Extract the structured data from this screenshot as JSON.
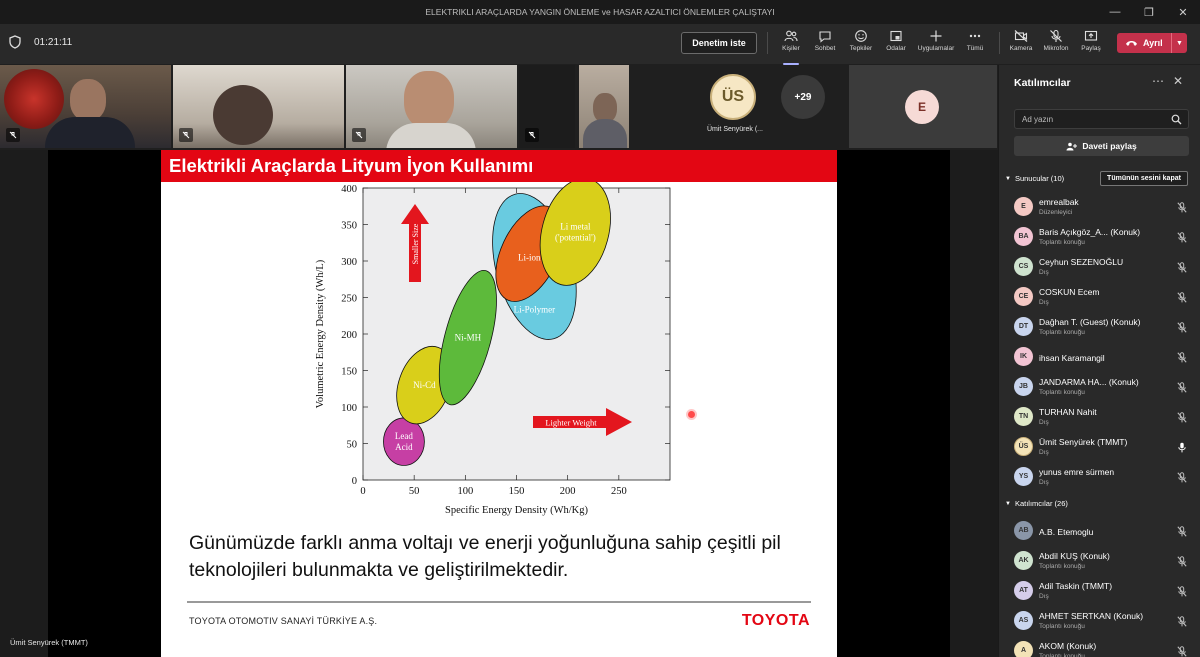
{
  "window": {
    "title": "ELEKTRIKLI ARAÇLARDA YANGIN ÖNLEME ve HASAR AZALTICI ÖNLEMLER ÇALIŞTAYI"
  },
  "toolbar": {
    "timer": "01:21:11",
    "raise_label": "Denetim iste",
    "buttons": [
      {
        "label": "Kişiler",
        "icon": "people-icon"
      },
      {
        "label": "Sohbet",
        "icon": "chat-icon"
      },
      {
        "label": "Tepkiler",
        "icon": "reactions-icon"
      },
      {
        "label": "Odalar",
        "icon": "rooms-icon"
      },
      {
        "label": "Uygulamalar",
        "icon": "apps-icon"
      },
      {
        "label": "Tümü",
        "icon": "more-icon"
      },
      {
        "label": "Kamera",
        "icon": "camera-off-icon"
      },
      {
        "label": "Mikrofon",
        "icon": "mic-off-icon"
      },
      {
        "label": "Paylaş",
        "icon": "share-icon"
      }
    ],
    "leave_label": "Ayrıl"
  },
  "tiles": {
    "us_initials": "ÜS",
    "us_name": "Ümit Senyürek (...",
    "more_count": "+29",
    "e_initial": "E"
  },
  "slide": {
    "title": "Elektrikli Araçlarda Lityum İyon Kullanımı",
    "body": "Günümüzde farklı anma voltajı ve enerji yoğunluğuna sahip çeşitli pil teknolojileri bulunmakta ve geliştirilmektedir.",
    "company": "TOYOTA  OTOMOTIV SANAYİ TÜRKİYE A.Ş.",
    "logo": "TOYOTA"
  },
  "chart_data": {
    "type": "scatter",
    "xlabel": "Specific Energy Density (Wh/Kg)",
    "ylabel": "Volumetric Energy Density (Wh/L)",
    "xlim": [
      0,
      300
    ],
    "ylim": [
      0,
      400
    ],
    "x_ticks": [
      0,
      50,
      100,
      150,
      200,
      250
    ],
    "y_ticks": [
      0,
      50,
      100,
      150,
      200,
      250,
      300,
      350,
      400
    ],
    "regions": [
      {
        "name": "Lead Acid",
        "lines": [
          "Lead",
          "Acid"
        ],
        "x": [
          20,
          60
        ],
        "y": [
          20,
          85
        ],
        "color": "#c63fa4"
      },
      {
        "name": "Ni-Cd",
        "lines": [
          "Ni-Cd"
        ],
        "x": [
          35,
          85
        ],
        "y": [
          75,
          185
        ],
        "color": "#d9cf1a"
      },
      {
        "name": "Ni-MH",
        "lines": [
          "Ni-MH"
        ],
        "x": [
          80,
          125
        ],
        "y": [
          100,
          290
        ],
        "color": "#5dba3b"
      },
      {
        "name": "Li-Polymer",
        "lines": [
          "Li-Polymer"
        ],
        "x": [
          130,
          205
        ],
        "y": [
          190,
          395
        ],
        "color": "#69cbe0"
      },
      {
        "name": "Li-ion",
        "lines": [
          "Li-ion"
        ],
        "x": [
          135,
          190
        ],
        "y": [
          240,
          380
        ],
        "color": "#e8601d"
      },
      {
        "name": "Li metal ('potential')",
        "lines": [
          "Li metal",
          "('potential')"
        ],
        "x": [
          175,
          240
        ],
        "y": [
          265,
          415
        ],
        "color": "#d9cf1a"
      }
    ],
    "annotations": [
      {
        "text": "Smaller Size",
        "direction": "up"
      },
      {
        "text": "Lighter Weight",
        "direction": "right"
      }
    ]
  },
  "presenter_label": "Ümit Senyürek (TMMT)",
  "panel": {
    "title": "Katılımcılar",
    "search_placeholder": "Ad yazın",
    "share_label": "Daveti paylaş",
    "presenters_label": "Sunucular (10)",
    "mute_all_label": "Tümünün sesini kapat",
    "attendees_label": "Katılımcılar (26)",
    "presenters": [
      {
        "initials": "E",
        "name": "emrealbak",
        "role": "Düzenleyici",
        "color": "#f4c9c4"
      },
      {
        "initials": "BA",
        "name": "Baris Açıkgöz_A...  (Konuk)",
        "role": "Toplantı konuğu",
        "color": "#f2c4d3"
      },
      {
        "initials": "CS",
        "name": "Ceyhun SEZENOĞLU",
        "role": "Dış",
        "color": "#cfe3cf"
      },
      {
        "initials": "CE",
        "name": "COSKUN Ecem",
        "role": "Dış",
        "color": "#f4c9c4"
      },
      {
        "initials": "DT",
        "name": "Dağhan T. (Guest) (Konuk)",
        "role": "Toplantı konuğu",
        "color": "#c9d5ee"
      },
      {
        "initials": "IK",
        "name": "ihsan Karamangil",
        "role": "",
        "color": "#f2c4d3"
      },
      {
        "initials": "JB",
        "name": "JANDARMA HA...  (Konuk)",
        "role": "Toplantı konuğu",
        "color": "#c9d5ee"
      },
      {
        "initials": "TN",
        "name": "TURHAN Nahit",
        "role": "Dış",
        "color": "#dfe8c8"
      },
      {
        "initials": "ÜS",
        "name": "Ümit Senyürek (TMMT)",
        "role": "Dış",
        "color": "#f3e3b7"
      },
      {
        "initials": "YS",
        "name": "yunus emre sürmen",
        "role": "Dış",
        "color": "#c9d5ee"
      }
    ],
    "attendees": [
      {
        "initials": "AB",
        "name": "A.B. Etemoglu",
        "role": "",
        "color": "#8a96a8"
      },
      {
        "initials": "AK",
        "name": "Abdil KUŞ (Konuk)",
        "role": "Toplantı konuğu",
        "color": "#cfe3cf"
      },
      {
        "initials": "AT",
        "name": "Adil Taskin (TMMT)",
        "role": "Dış",
        "color": "#d5cdea"
      },
      {
        "initials": "AS",
        "name": "AHMET SERTKAN (Konuk)",
        "role": "Toplantı konuğu",
        "color": "#c9d5ee"
      },
      {
        "initials": "A",
        "name": "AKOM (Konuk)",
        "role": "Toplantı konuğu",
        "color": "#f3e3b7"
      }
    ]
  }
}
